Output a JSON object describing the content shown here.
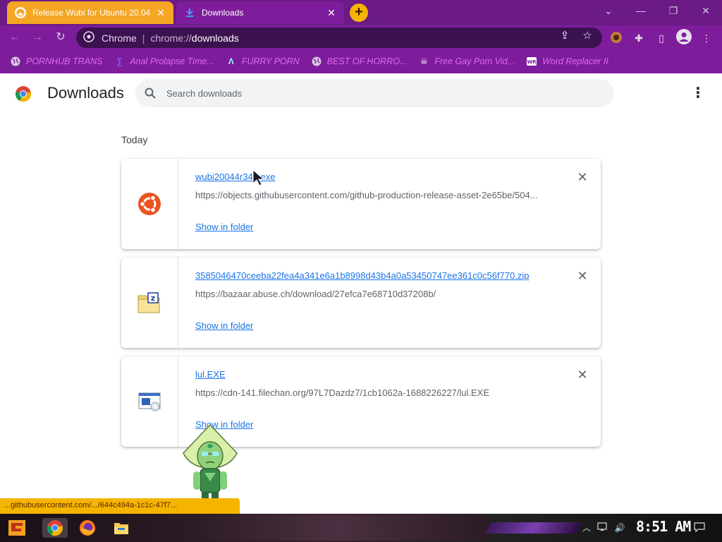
{
  "tabs": [
    {
      "title": "Release Wubi for Ubuntu 20.04",
      "icon": "github-icon"
    },
    {
      "title": "Downloads",
      "icon": "download-icon"
    }
  ],
  "omnibox": {
    "site": "Chrome",
    "scheme": "chrome://",
    "path": "downloads"
  },
  "bookmarks": [
    {
      "label": "PORNHUB TRANS",
      "icon": "globe-icon"
    },
    {
      "label": "Anal Prolapse Time...",
      "icon": "bookmark-sigma-icon"
    },
    {
      "label": "FURRY PORN",
      "icon": "bookmark-lambda-icon"
    },
    {
      "label": "BEST OF HORRO...",
      "icon": "globe-icon"
    },
    {
      "label": "Free Gay Porn Vid...",
      "icon": "bookmark-skull-icon"
    },
    {
      "label": "Word Replacer II",
      "icon": "bookmark-wr-icon"
    }
  ],
  "page": {
    "title": "Downloads",
    "search_placeholder": "Search downloads",
    "date_group": "Today"
  },
  "downloads": [
    {
      "filename": "wubi20044r344.exe",
      "url": "https://objects.githubusercontent.com/github-production-release-asset-2e65be/504...",
      "action": "Show in folder",
      "icon": "ubuntu-icon"
    },
    {
      "filename": "3585046470ceeba22fea4a341e6a1b8998d43b4a0a53450747ee361c0c56f770.zip",
      "url": "https://bazaar.abuse.ch/download/27efca7e68710d37208b/",
      "action": "Show in folder",
      "icon": "zip-folder-icon"
    },
    {
      "filename": "lul.EXE",
      "url": "https://cdn-141.filechan.org/97L7Dazdz7/1cb1062a-1688226227/lul.EXE",
      "action": "Show in folder",
      "icon": "exe-setup-icon"
    }
  ],
  "status_url": "...githubusercontent.com/.../644c494a-1c1c-47f7...",
  "taskbar": {
    "clock": "8:51 AM",
    "apps": [
      "start-icon",
      "chrome-icon",
      "firefox-icon",
      "file-explorer-icon"
    ]
  },
  "colors": {
    "frame": "#7d1d9b",
    "tab_active_other": "#f5a623",
    "link": "#1a73e8",
    "bookmark_text": "#e266f3"
  }
}
